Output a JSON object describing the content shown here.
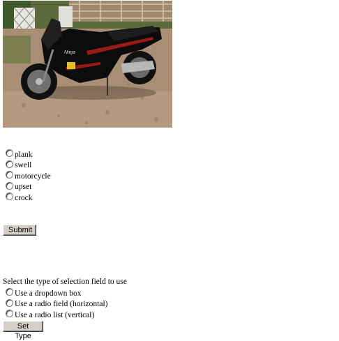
{
  "photo": {
    "subject": "black motorcycle parked on dirt ground",
    "brand_text": "Ninja"
  },
  "question": {
    "options": [
      {
        "label": "plank",
        "checked": false
      },
      {
        "label": "swell",
        "checked": false
      },
      {
        "label": "motorcycle",
        "checked": false
      },
      {
        "label": "upset",
        "checked": false
      },
      {
        "label": "crock",
        "checked": false
      }
    ],
    "submit_label": "Submit"
  },
  "selection_type": {
    "prompt": "Select the type of selection field to use",
    "options": [
      {
        "label": "Use a dropdown box",
        "checked": false
      },
      {
        "label": "Use a radio field (horizontal)",
        "checked": false
      },
      {
        "label": "Use a radio list (vertical)",
        "checked": false
      }
    ],
    "set_type_label": "Set Type"
  },
  "colors": {
    "button_face": "#d4d0c8",
    "page_background": "#ffffff"
  }
}
